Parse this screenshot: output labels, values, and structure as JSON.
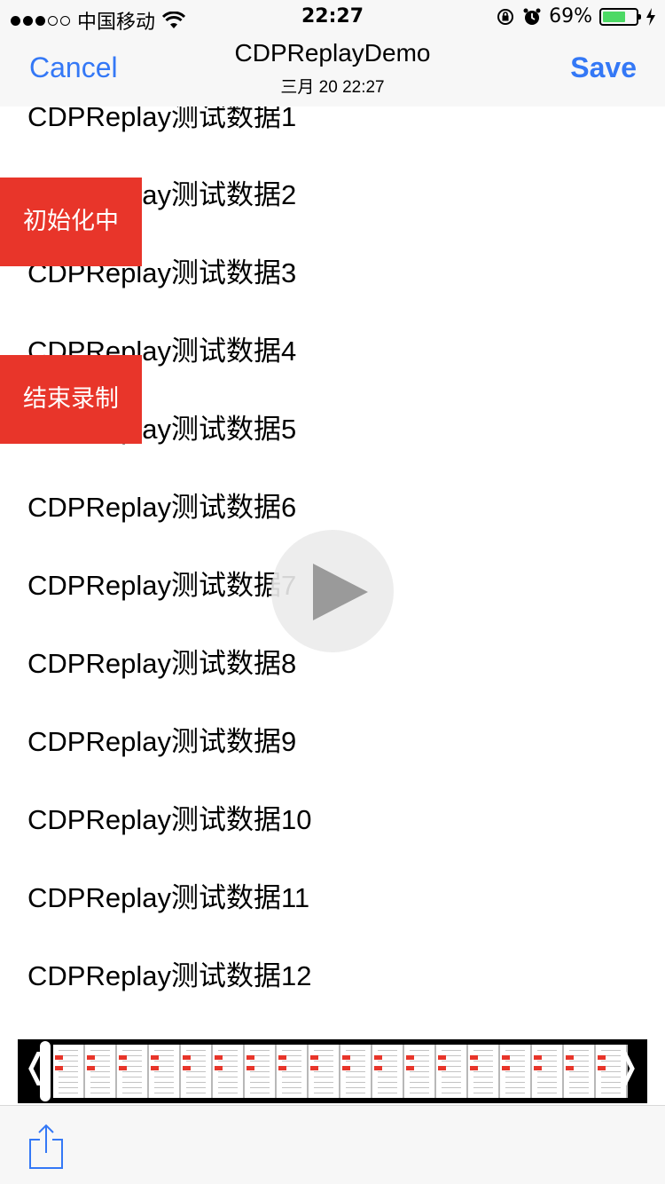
{
  "status": {
    "carrier": "中国移动",
    "time": "22:27",
    "battery": "69%",
    "battery_level": 0.69
  },
  "nav": {
    "cancel": "Cancel",
    "title": "CDPReplayDemo",
    "subtitle": "三月 20 22:27",
    "save": "Save"
  },
  "list": {
    "items": [
      "CDPReplay测试数据1",
      "CDPReplay测试数据2",
      "CDPReplay测试数据3",
      "CDPReplay测试数据4",
      "CDPReplay测试数据5",
      "CDPReplay测试数据6",
      "CDPReplay测试数据7",
      "CDPReplay测试数据8",
      "CDPReplay测试数据9",
      "CDPReplay测试数据10",
      "CDPReplay测试数据11",
      "CDPReplay测试数据12"
    ]
  },
  "buttons": {
    "init": "初始化中",
    "stop": "结束录制"
  },
  "colors": {
    "accent": "#3478f6",
    "red": "#e8352a",
    "battery_green": "#4cd964"
  },
  "icons": {
    "play": "play-icon",
    "share": "share-icon",
    "prev": "chevron-left-icon",
    "next": "chevron-right-icon"
  }
}
